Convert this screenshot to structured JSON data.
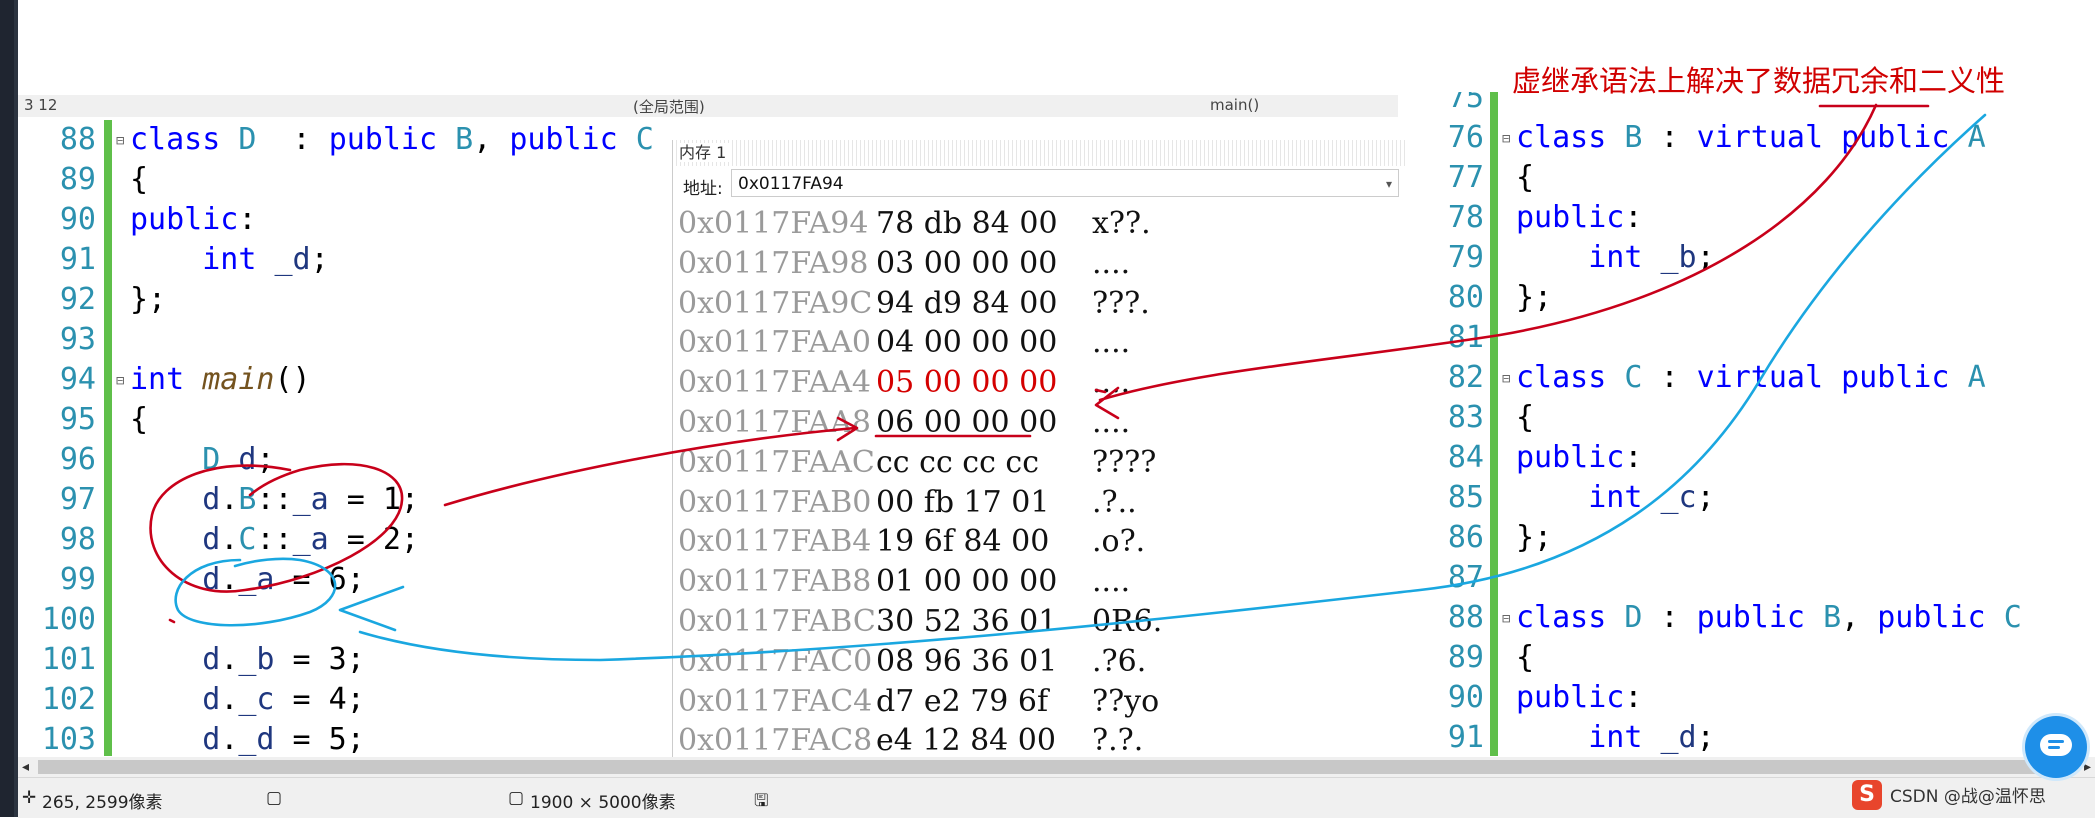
{
  "annotation": "虚继承语法上解决了数据冗余和二义性",
  "left_editor": {
    "lines": [
      {
        "num": "88",
        "fold": "⊟",
        "parts": [
          [
            "kw",
            "class "
          ],
          [
            "ty",
            "D"
          ],
          [
            "",
            "  : "
          ],
          [
            "kw",
            "public "
          ],
          [
            "ty",
            "B"
          ],
          [
            "",
            ", "
          ],
          [
            "kw",
            "public "
          ],
          [
            "ty",
            "C"
          ]
        ]
      },
      {
        "num": "89",
        "fold": "",
        "parts": [
          [
            "",
            "{"
          ]
        ]
      },
      {
        "num": "90",
        "fold": "",
        "parts": [
          [
            "kw",
            "public"
          ],
          [
            "",
            ":"
          ]
        ]
      },
      {
        "num": "91",
        "fold": "",
        "parts": [
          [
            "",
            "    "
          ],
          [
            "kw",
            "int "
          ],
          [
            "var",
            "_d"
          ],
          [
            "",
            ";"
          ]
        ]
      },
      {
        "num": "92",
        "fold": "",
        "parts": [
          [
            "",
            "};"
          ]
        ]
      },
      {
        "num": "93",
        "fold": "",
        "parts": []
      },
      {
        "num": "94",
        "fold": "⊟",
        "parts": [
          [
            "kw",
            "int "
          ],
          [
            "fn",
            "main"
          ],
          [
            "",
            "()"
          ]
        ]
      },
      {
        "num": "95",
        "fold": "",
        "parts": [
          [
            "",
            "{"
          ]
        ]
      },
      {
        "num": "96",
        "fold": "",
        "parts": [
          [
            "",
            "    "
          ],
          [
            "ty",
            "D"
          ],
          [
            "",
            " "
          ],
          [
            "var",
            "d"
          ],
          [
            "",
            ";"
          ]
        ]
      },
      {
        "num": "97",
        "fold": "",
        "parts": [
          [
            "",
            "    "
          ],
          [
            "var",
            "d"
          ],
          [
            "",
            "."
          ],
          [
            "ty",
            "B"
          ],
          [
            "",
            "::"
          ],
          [
            "var",
            "_a"
          ],
          [
            "",
            " = 1;"
          ]
        ]
      },
      {
        "num": "98",
        "fold": "",
        "parts": [
          [
            "",
            "    "
          ],
          [
            "var",
            "d"
          ],
          [
            "",
            "."
          ],
          [
            "ty",
            "C"
          ],
          [
            "",
            "::"
          ],
          [
            "var",
            "_a"
          ],
          [
            "",
            " = 2;"
          ]
        ]
      },
      {
        "num": "99",
        "fold": "",
        "parts": [
          [
            "",
            "    "
          ],
          [
            "var",
            "d"
          ],
          [
            "",
            "."
          ],
          [
            "var",
            "_a"
          ],
          [
            "",
            " = 6;"
          ]
        ]
      },
      {
        "num": "100",
        "fold": "",
        "parts": []
      },
      {
        "num": "101",
        "fold": "",
        "parts": [
          [
            "",
            "    "
          ],
          [
            "var",
            "d"
          ],
          [
            "",
            "."
          ],
          [
            "var",
            "_b"
          ],
          [
            "",
            " = 3;"
          ]
        ]
      },
      {
        "num": "102",
        "fold": "",
        "parts": [
          [
            "",
            "    "
          ],
          [
            "var",
            "d"
          ],
          [
            "",
            "."
          ],
          [
            "var",
            "_c"
          ],
          [
            "",
            " = 4;"
          ]
        ]
      },
      {
        "num": "103",
        "fold": "",
        "parts": [
          [
            "",
            "    "
          ],
          [
            "var",
            "d"
          ],
          [
            "",
            "."
          ],
          [
            "var",
            "_d"
          ],
          [
            "",
            " = 5;"
          ]
        ]
      }
    ]
  },
  "right_editor": {
    "lines": [
      {
        "num": "75",
        "fold": "",
        "parts": []
      },
      {
        "num": "76",
        "fold": "⊟",
        "parts": [
          [
            "kw",
            "class "
          ],
          [
            "ty",
            "B"
          ],
          [
            "",
            " : "
          ],
          [
            "kw",
            "virtual public "
          ],
          [
            "ty",
            "A"
          ]
        ]
      },
      {
        "num": "77",
        "fold": "",
        "parts": [
          [
            "",
            "{"
          ]
        ]
      },
      {
        "num": "78",
        "fold": "",
        "parts": [
          [
            "kw",
            "public"
          ],
          [
            "",
            ":"
          ]
        ]
      },
      {
        "num": "79",
        "fold": "",
        "parts": [
          [
            "",
            "    "
          ],
          [
            "kw",
            "int "
          ],
          [
            "var",
            "_b"
          ],
          [
            "",
            ";"
          ]
        ]
      },
      {
        "num": "80",
        "fold": "",
        "parts": [
          [
            "",
            "};"
          ]
        ]
      },
      {
        "num": "81",
        "fold": "",
        "parts": []
      },
      {
        "num": "82",
        "fold": "⊟",
        "parts": [
          [
            "kw",
            "class "
          ],
          [
            "ty",
            "C"
          ],
          [
            "",
            " : "
          ],
          [
            "kw",
            "virtual public "
          ],
          [
            "ty",
            "A"
          ]
        ]
      },
      {
        "num": "83",
        "fold": "",
        "parts": [
          [
            "",
            "{"
          ]
        ]
      },
      {
        "num": "84",
        "fold": "",
        "parts": [
          [
            "kw",
            "public"
          ],
          [
            "",
            ":"
          ]
        ]
      },
      {
        "num": "85",
        "fold": "",
        "parts": [
          [
            "",
            "    "
          ],
          [
            "kw",
            "int "
          ],
          [
            "var",
            "_c"
          ],
          [
            "",
            ";"
          ]
        ]
      },
      {
        "num": "86",
        "fold": "",
        "parts": [
          [
            "",
            "};"
          ]
        ]
      },
      {
        "num": "87",
        "fold": "",
        "parts": []
      },
      {
        "num": "88",
        "fold": "⊟",
        "parts": [
          [
            "kw",
            "class "
          ],
          [
            "ty",
            "D"
          ],
          [
            "",
            " : "
          ],
          [
            "kw",
            "public "
          ],
          [
            "ty",
            "B"
          ],
          [
            "",
            ", "
          ],
          [
            "kw",
            "public "
          ],
          [
            "ty",
            "C"
          ]
        ]
      },
      {
        "num": "89",
        "fold": "",
        "parts": [
          [
            "",
            "{"
          ]
        ]
      },
      {
        "num": "90",
        "fold": "",
        "parts": [
          [
            "kw",
            "public"
          ],
          [
            "",
            ":"
          ]
        ]
      },
      {
        "num": "91",
        "fold": "",
        "parts": [
          [
            "",
            "    "
          ],
          [
            "kw",
            "int "
          ],
          [
            "var",
            "_d"
          ],
          [
            "",
            ";"
          ]
        ]
      }
    ]
  },
  "nav": {
    "left": "3 12",
    "mid": "(全局范围)",
    "right": "main()"
  },
  "memory": {
    "title": "内存 1",
    "address_label": "地址:",
    "address_value": "0x0117FA94",
    "rows": [
      {
        "addr": "0x0117FA94",
        "bytes": "78 db 84 00",
        "ascii": "x??.",
        "changed": false
      },
      {
        "addr": "0x0117FA98",
        "bytes": "03 00 00 00",
        "ascii": "....",
        "changed": false
      },
      {
        "addr": "0x0117FA9C",
        "bytes": "94 d9 84 00",
        "ascii": "???.",
        "changed": false
      },
      {
        "addr": "0x0117FAA0",
        "bytes": "04 00 00 00",
        "ascii": "....",
        "changed": false
      },
      {
        "addr": "0x0117FAA4",
        "bytes": "05 00 00 00",
        "ascii": "....",
        "changed": true
      },
      {
        "addr": "0x0117FAA8",
        "bytes": "06 00 00 00",
        "ascii": "....",
        "changed": false
      },
      {
        "addr": "0x0117FAAC",
        "bytes": "cc cc cc cc",
        "ascii": "????",
        "changed": false
      },
      {
        "addr": "0x0117FAB0",
        "bytes": "00 fb 17 01",
        "ascii": ".?..",
        "changed": false
      },
      {
        "addr": "0x0117FAB4",
        "bytes": "19 6f 84 00",
        "ascii": ".o?.",
        "changed": false
      },
      {
        "addr": "0x0117FAB8",
        "bytes": "01 00 00 00",
        "ascii": "....",
        "changed": false
      },
      {
        "addr": "0x0117FABC",
        "bytes": "30 52 36 01",
        "ascii": "0R6.",
        "changed": false
      },
      {
        "addr": "0x0117FAC0",
        "bytes": "08 96 36 01",
        "ascii": ".?6.",
        "changed": false
      },
      {
        "addr": "0x0117FAC4",
        "bytes": "d7 e2 79 6f",
        "ascii": "??yo",
        "changed": false
      },
      {
        "addr": "0x0117FAC8",
        "bytes": "e4 12 84 00",
        "ascii": "?.?.",
        "changed": false
      }
    ]
  },
  "status": {
    "cursor": "265, 2599像素",
    "size": "1900 × 5000像素"
  },
  "watermark": "CSDN @战@温怀思",
  "colors": {
    "annotation_red": "#d00000",
    "ink_blue": "#1aa7e0",
    "gutter_green": "#5fbf4a",
    "changed_red": "#d40000"
  }
}
